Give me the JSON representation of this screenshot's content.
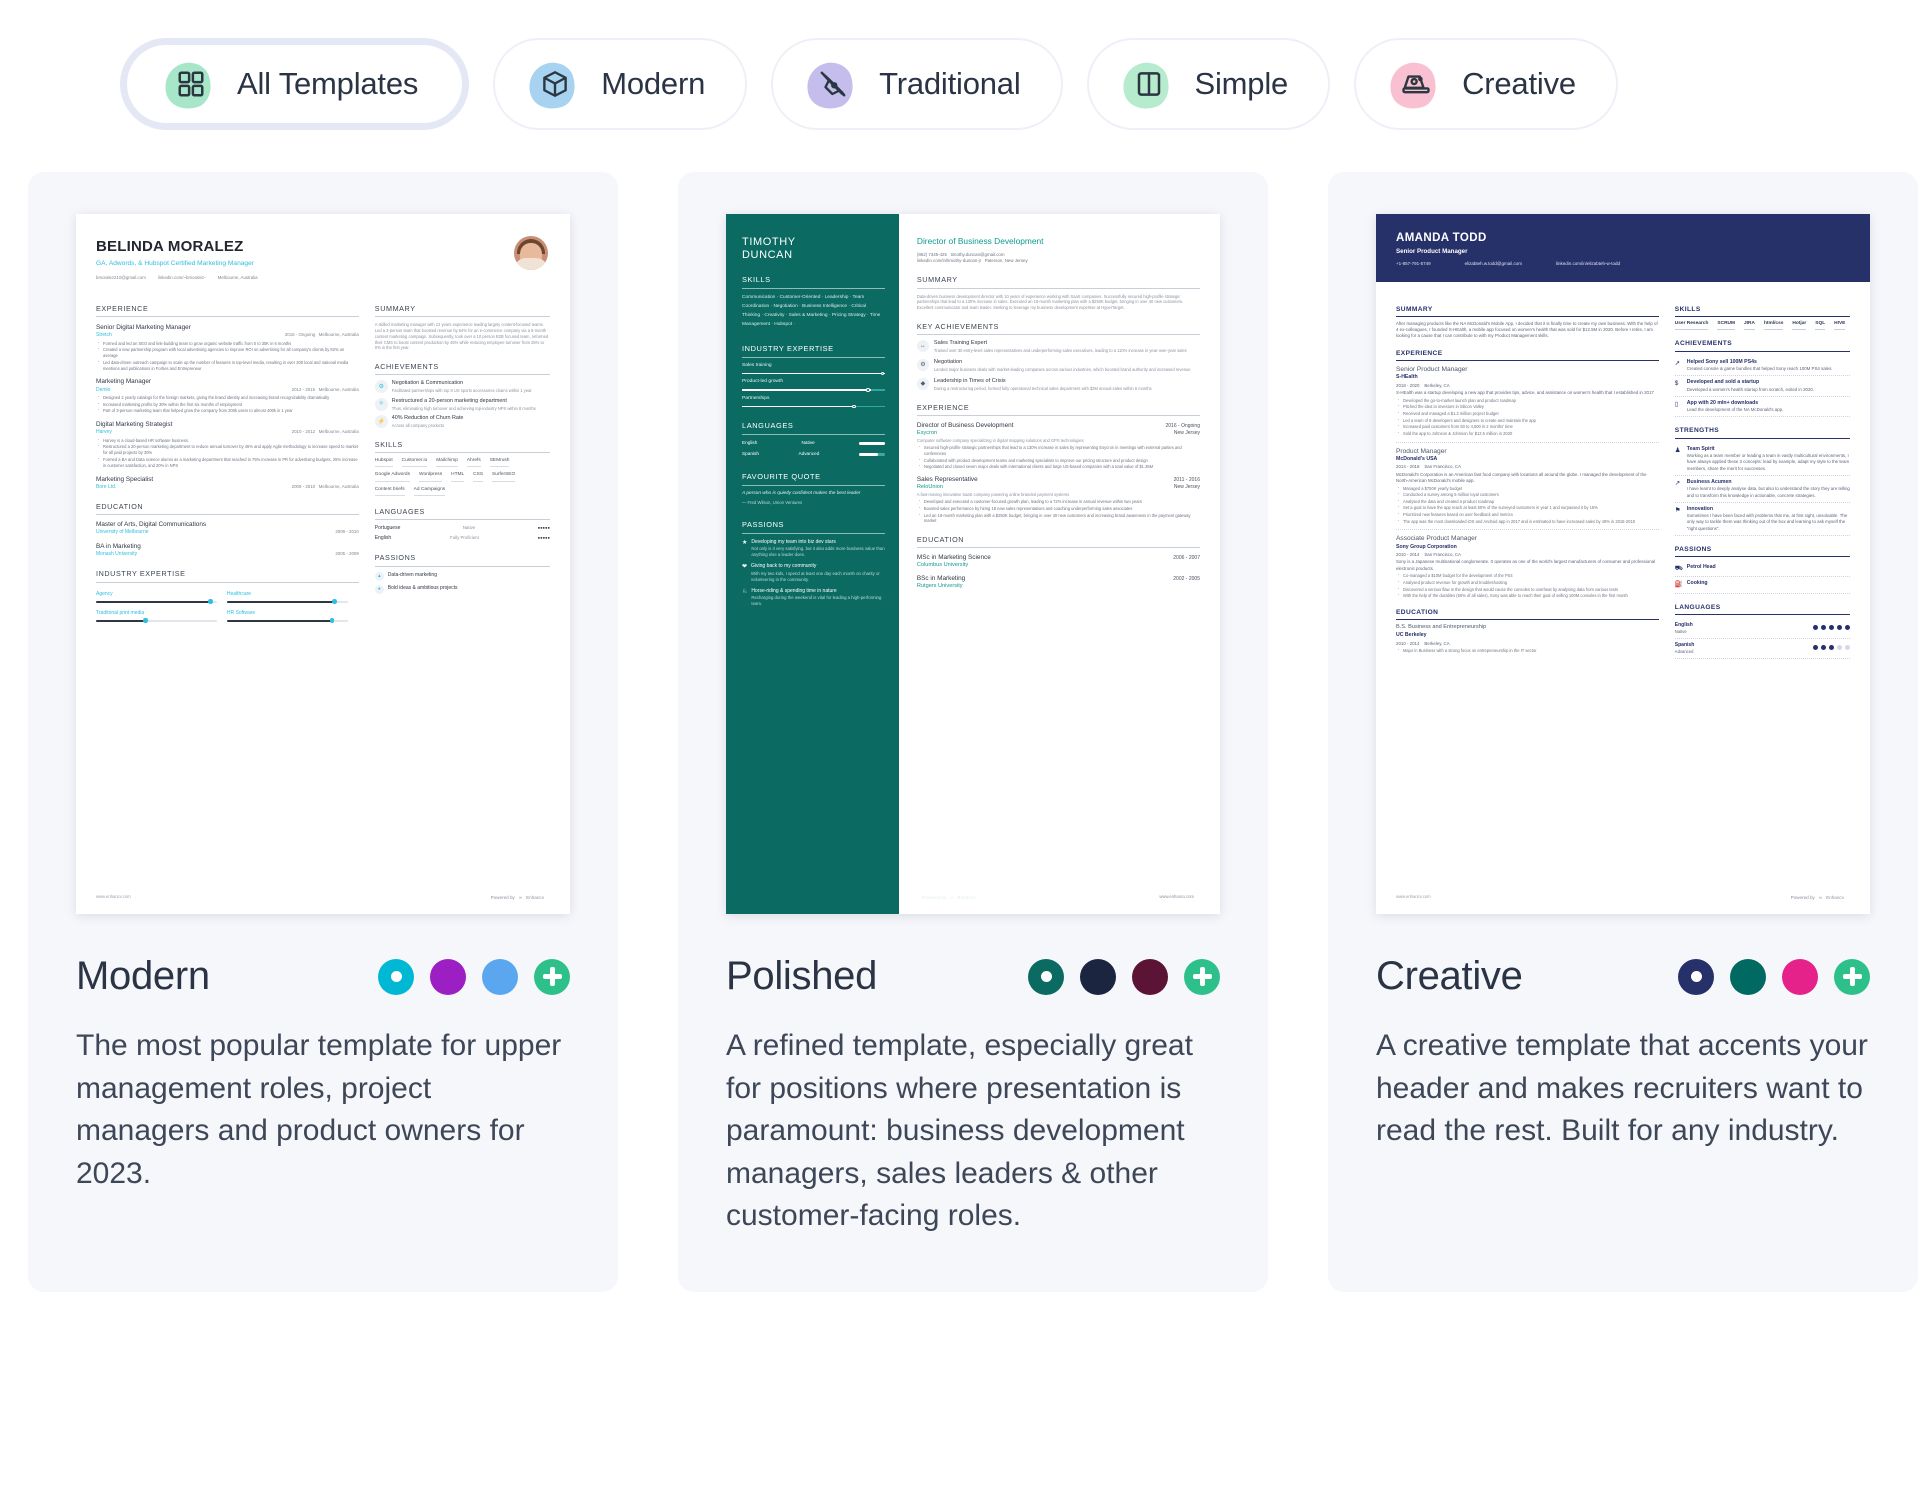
{
  "filters": {
    "tabs": [
      {
        "label": "All Templates",
        "icon": "grid-icon",
        "blob": "green",
        "active": true
      },
      {
        "label": "Modern",
        "icon": "cube-icon",
        "blob": "blue",
        "active": false
      },
      {
        "label": "Traditional",
        "icon": "pen-nib-icon",
        "blob": "purple",
        "active": false
      },
      {
        "label": "Simple",
        "icon": "columns-icon",
        "blob": "green2",
        "active": false
      },
      {
        "label": "Creative",
        "icon": "camera-icon",
        "blob": "pink",
        "active": false
      }
    ]
  },
  "cards": [
    {
      "title": "Modern",
      "description": "The most popular template for upper management roles, project managers and product owners for 2023.",
      "swatches": [
        "#00b8d4",
        "#9c1fc4",
        "#5aa7ef"
      ],
      "selected_swatch_index": 0,
      "add_label": "+"
    },
    {
      "title": "Polished",
      "description": "A refined template, especially great for positions where presentation is paramount: business development managers, sales leaders & other customer-facing roles.",
      "swatches": [
        "#0b6b63",
        "#1b2540",
        "#5c1436"
      ],
      "selected_swatch_index": 0,
      "add_label": "+"
    },
    {
      "title": "Creative",
      "description": "A creative template that accents your header and makes recruiters want to read the rest. Built for any industry.",
      "swatches": [
        "#263069",
        "#006a62",
        "#e52289"
      ],
      "selected_swatch_index": 0,
      "add_label": "+"
    }
  ],
  "resume1": {
    "name": "BELINDA MORALEZ",
    "role": "GA, Adwords, & Hubspot Certified Marketing Manager",
    "contacts": [
      "bmoralez210@gmail.com",
      "linkedin.com/~bmoralez-",
      "Melbourne, Australia"
    ],
    "experience_title": "EXPERIENCE",
    "jobs": [
      {
        "title": "Senior Digital Marketing Manager",
        "company": "Stretch",
        "dates": "2015 - Ongoing",
        "location": "Melbourne, Australia",
        "bullets": [
          "Formed and led an SEO and link-building team to grow organic website traffic from 0 to 30K in 6 months",
          "Created a new partnership program with local advertising agencies to improve ROI on advertising for all company's clients by 82% on average",
          "Led data-driven outreach campaign to scale up the number of features in top-level media, resulting in over 200 local and national media mentions and publications in Forbes and Entrepreneur"
        ]
      },
      {
        "title": "Marketing Manager",
        "company": "Demio",
        "dates": "2012 - 2015",
        "location": "Melbourne, Australia",
        "bullets": [
          "Designed 2 yearly catalogs for the foreign markets, giving the brand identity and increasing brand recognizability dramatically",
          "Increased marketing profits by 30% within the first six months of employment",
          "Part of 3-person marketing team that helped grow the company from 200k users to almost 400k in 1 year"
        ]
      },
      {
        "title": "Digital Marketing Strategist",
        "company": "Harvey",
        "dates": "2010 - 2012",
        "location": "Melbourne, Australia",
        "bullets": [
          "Harvey is a cloud-based HR software business.",
          "Restructured a 20-person marketing department to reduce annual turnover by 46% and apply Agile methodology to increase speed to market for all paid projects by 30%",
          "Formed a BA and Data science alumni as a marketing department that reached in 75% increase in PR for advertising budgets, 25% increase in customer satisfaction, and 20% in NPS"
        ]
      },
      {
        "title": "Marketing Specialist",
        "company": "Bore Ltd.",
        "dates": "2009 - 2010",
        "location": "Melbourne, Australia",
        "bullets": []
      }
    ],
    "education_title": "EDUCATION",
    "education": [
      {
        "degree": "Master of Arts, Digital Communications",
        "school": "University of Melbourne",
        "dates": "2009 - 2010"
      },
      {
        "degree": "BA in Marketing",
        "school": "Monash University",
        "dates": "2005 - 2009"
      }
    ],
    "expertise_title": "INDUSTRY EXPERTISE",
    "expertise": [
      {
        "label": "Agency",
        "value": 96
      },
      {
        "label": "Healthcare",
        "value": 90
      },
      {
        "label": "Traditonal print media",
        "value": 42
      },
      {
        "label": "HR Software",
        "value": 88
      }
    ],
    "summary_title": "SUMMARY",
    "summary": "A skilled marketing manager with 12 years experience leading largely content-focused teams. Led a 3-person team that boosted revenue by 64% for an e-commerce company via a 6-month content marketing campaign. Subsequently, took over a 10 person B2B focused team, reformed their CMS to boost content production by 45% while reducing employee turnover from 25% to 0% in the first year.",
    "achievements_title": "ACHIEVEMENTS",
    "achievements": [
      {
        "icon": "handshake-icon",
        "title": "Negotiation & Communication",
        "desc": "Facilitated partnerships with top 8 US sports accessories chains within 1 year"
      },
      {
        "icon": "network-icon",
        "title": "Restructured a 20-person marketing department",
        "desc": "Thus, eliminating high turnover and achieving top-industry NPS within 8 months"
      },
      {
        "icon": "bolt-icon",
        "title": "40% Reduction of Churn Rate",
        "desc": "Across all company products"
      }
    ],
    "skills_title": "SKILLS",
    "skills": [
      "Hubspot",
      "Customer.io",
      "Mailchimp",
      "Ahrefs",
      "SEMrush",
      "Google Adwords",
      "Wordpress",
      "HTML",
      "CSS",
      "SurferSEO",
      "Content briefs",
      "Ad Campaigns"
    ],
    "languages_title": "LANGUAGES",
    "languages": [
      {
        "name": "Portuguese",
        "level": "Native",
        "pips": 5
      },
      {
        "name": "English",
        "level": "Fully Proficient",
        "pips": 5
      }
    ],
    "passions_title": "PASSIONS",
    "passions": [
      "Data-driven marketing",
      "Bold ideas & ambitious projects"
    ],
    "site": "www.enhancv.com",
    "powered_by": "Powered by",
    "brand": "Enhancv"
  },
  "resume2": {
    "name": "TIMOTHY\nDUNCAN",
    "skills_title": "SKILLS",
    "skills_text": "Communication · Customer-Oriented · Leadership · Team Coordination · Negotiation · Business Intelligence · Critical Thinking · Creativity · Sales & Marketing · Pricing Strategy · Time Management · Hubspot ·",
    "expertise_title": "INDUSTRY EXPERTISE",
    "expertise": [
      {
        "label": "Sales training",
        "value": 100
      },
      {
        "label": "Product-led growth",
        "value": 90
      },
      {
        "label": "Partnerships",
        "value": 80
      }
    ],
    "languages_title": "LANGUAGES",
    "languages": [
      {
        "name": "English",
        "level": "Native",
        "pct": 100
      },
      {
        "name": "Spanish",
        "level": "Advanced",
        "pct": 75
      }
    ],
    "quote_title": "FAVOURITE QUOTE",
    "quote": "A person who is quietly confident makes the best leader",
    "quote_author": "— Fred Wilson, Union Ventures",
    "passions_title": "PASSIONS",
    "passions": [
      {
        "icon": "star-icon",
        "title": "Developing my team into biz dev stars",
        "desc": "Not only is it very satisfying, but it also adds more business value than anything else a leader does."
      },
      {
        "icon": "heart-icon",
        "title": "Giving back to my community",
        "desc": "With my two kids, I spend at least one day each month on charity or volunteering in the community."
      },
      {
        "icon": "horse-icon",
        "title": "Horse-riding & spending time in nature",
        "desc": "Recharging during the weekend is vital for leading a high-performing team."
      }
    ],
    "role": "Director of Business Development",
    "contacts": [
      "(862) 7345-425",
      "timothy.duncan@gmail.com",
      "linkedin.com/in/timothy-duncan-jr",
      "Paterson, New Jersey"
    ],
    "summary_title": "SUMMARY",
    "summary": "Data-driven business development director with 10 years of experience working with SaaS companies. Successfully secured high-profile strategic partnerships that lead to a 130% increase in sales. Executed an 18-month marketing plan with a $250K budget, bringing in over 40 new customers. Excellent communicator and team leader. Seeking to leverage my business development expertise at HyperTarget.",
    "achievements_title": "KEY ACHIEVEMENTS",
    "achievements": [
      {
        "icon": "arrows-icon",
        "title": "Sales Training Expert",
        "desc": "Trained over 30 entry-level sales representatives and underperforming sales executives, leading to a 110% increase in year-over-year sales"
      },
      {
        "icon": "handshake-icon",
        "title": "Negotiation",
        "desc": "Landed major business deals with market-leading companies across various industries, which boosted brand authority and increased revenue"
      },
      {
        "icon": "diamond-icon",
        "title": "Leadership in Times of Crisis",
        "desc": "During a restructuring period, formed fully operational technical sales department with $3M annual sales within 6 months"
      }
    ],
    "experience_title": "EXPERIENCE",
    "jobs": [
      {
        "title": "Director of Business Development",
        "company": "Esycron",
        "dates": "2016 - Ongoing",
        "location": "New Jersey",
        "intro": "Computer software company specializing in digital mapping solutions and GPS technologies",
        "bullets": [
          "Secured high-profile strategic partnerships that lead to a 130% increase in sales by representing Esycron in meetings with external parties and conferences",
          "Collaborated with product development teams and marketing specialists to improve our pricing structure and product design",
          "Negotiated and closed seven major deals with international clients and large US-based companies with a total value of $1.35M"
        ]
      },
      {
        "title": "Sales Representative",
        "company": "ReloUnion",
        "dates": "2011 - 2016",
        "location": "New Jersey",
        "intro": "A fast-moving innovative SaaS company powering online branded payment systems",
        "bullets": [
          "Developed and executed a customer-focused growth plan, leading to a 72% increase in annual revenue within two years",
          "Boosted sales performance by hiring 18 new sales representatives and coaching underperforming sales associates",
          "Led an 18-month marketing plan with a $250K budget, bringing in over 40 new customers and increasing brand awareness in the payment gateway market"
        ]
      }
    ],
    "education_title": "EDUCATION",
    "education": [
      {
        "degree": "MSc in Marketing Science",
        "school": "Columbus University",
        "dates": "2006 - 2007"
      },
      {
        "degree": "BSc in Marketing",
        "school": "Rutgers University",
        "dates": "2002 - 2005"
      }
    ],
    "site": "www.enhancv.com",
    "powered_by": "Powered by",
    "brand": "Enhancv"
  },
  "resume3": {
    "name": "AMANDA TODD",
    "role": "Senior Product Manager",
    "contacts": [
      "+1-857-791-5749",
      "elizabteh.w.todd@gmail.com",
      "linkedin.com/in/elizabteh-w-todd"
    ],
    "summary_title": "SUMMARY",
    "summary": "After managing products like the NA McDonald's Mobile App, I decided that it is finally time to create my own business. With the help of 4 ex-colleagues, I founded S-HEalth, a mobile app focused on women's health that was sold for $12.5M in 2020. Before I retire, I am looking for a cause that I can contribute to with my Product Management skills.",
    "experience_title": "EXPERIENCE",
    "jobs": [
      {
        "title": "Senior Product Manager",
        "company": "S-HEalth",
        "dates": "2018 - 2020",
        "location": "Berkeley, CA",
        "intro": "S-HEalth was a startup developing a new app that provides tips, advice, and assistance on women's health that I established in 2017",
        "bullets": [
          "Developed the go-to-market launch plan and product roadmap",
          "Pitched the idea to investors in Silicon Valley",
          "Received and managed a $1.2 million project budget",
          "Led a team of 8 developers and designers to create and maintain the app",
          "Increased paid customers from 50 to 4,500 in 2 months' time",
          "Sold the app to Johnson & Johnson for $12.5 million in 2020"
        ]
      },
      {
        "title": "Product Manager",
        "company": "McDonald's USA",
        "dates": "2014 - 2018",
        "location": "San Francisco, CA",
        "intro": "McDonald's Corporation is an American fast food company with locations all around the globe. I managed the development of the North-American McDonald's mobile app.",
        "bullets": [
          "Managed a $750K yearly budget",
          "Conducted a survey among 5 million loyal customers",
          "Analysed the data and created a product roadmap",
          "Set a goal to have the app reach at least 50% of the surveyed customers in year 1 and surpassed it by 15%",
          "Prioritized new features based on user feedback and metrics",
          "The app was the most downloaded iOS and Android app in 2017 and is estimated to have increased sales by 48% in 2015-2018"
        ]
      },
      {
        "title": "Associate Product Manager",
        "company": "Sony Group Corporation",
        "dates": "2010 - 2014",
        "location": "San Francisco, CA",
        "intro": "Sony is a Japanese multinational conglomerate. It operates as one of the world's largest manufacturers of consumer and professional electronic products.",
        "bullets": [
          "Co-managed a $10M budget for the development of the PS4",
          "Analysed product revenue for growth and troubleshooting",
          "Discovered a serious flaw in the design that would cause the consoles to overheat by analysing data from various tests",
          "With the help of the durables (50% of all sales), Sony was able to reach their goal of selling 100M consoles in the first month"
        ]
      }
    ],
    "education_title": "EDUCATION",
    "education": [
      {
        "degree": "B.S. Business and Entrepreneurship",
        "school": "UC Berkeley",
        "dates": "2010 - 2014",
        "location": "Berkeley, CA",
        "note": "Major in Business with a strong focus on entrepreneurship in the IT sector"
      }
    ],
    "skills_title": "SKILLS",
    "skills": [
      "User Research",
      "SCRUM",
      "JIRA",
      "html/css",
      "Hotjar",
      "SQL",
      "HIVE"
    ],
    "achievements_title": "ACHIEVEMENTS",
    "achievements": [
      {
        "icon": "rocket-icon",
        "title": "Helped Sony sell 100M PS4s",
        "desc": "Created console & game bundles that helped Sony reach 100M PS4 sales."
      },
      {
        "icon": "dollar-icon",
        "title": "Developed and sold a startup",
        "desc": "Developed a women's health startup from scratch, exited in 2020."
      },
      {
        "icon": "mobile-icon",
        "title": "App with 20 mln+ downloads",
        "desc": "Lead the development of the NA McDonald's app."
      }
    ],
    "strengths_title": "STRENGTHS",
    "strengths": [
      {
        "icon": "team-icon",
        "title": "Team Spirit",
        "desc": "Working as a team member or leading a team in vastly multicultural environments, I have always applied these 3 concepts: lead by example, adapt my style to the team members, share the merit for successes."
      },
      {
        "icon": "chart-icon",
        "title": "Business Acumen",
        "desc": "I have learnt to deeply analyse data, but also to understand the story they are telling and to transform this knowledge in actionable, concrete strategies."
      },
      {
        "icon": "bulb-icon",
        "title": "Innovation",
        "desc": "Sometimes I have been faced with problems that me, at first sight, unsolvable. The only way to tackle them was thinking out of the box and learning to ask myself the \"right questions\"."
      }
    ],
    "passions_title": "PASSIONS",
    "passions": [
      {
        "icon": "car-icon",
        "title": "Petrol Head"
      },
      {
        "icon": "cooking-icon",
        "title": "Cooking"
      }
    ],
    "languages_title": "LANGUAGES",
    "languages": [
      {
        "name": "English",
        "level": "Native",
        "pips": 5,
        "filled": 5
      },
      {
        "name": "Spanish",
        "level": "Advanced",
        "pips": 5,
        "filled": 3
      }
    ],
    "site": "www.enhancv.com",
    "powered_by": "Powered by",
    "brand": "Enhancv"
  }
}
